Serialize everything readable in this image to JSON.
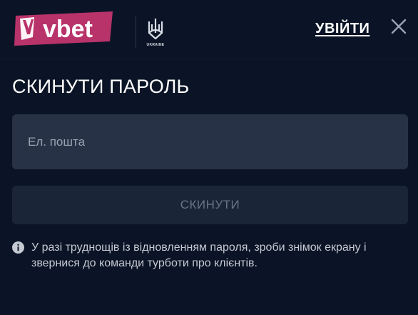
{
  "header": {
    "logo_text": "vbet",
    "partner_caption": "UKRAINE",
    "login_label": "УВІЙТИ"
  },
  "form": {
    "title": "СКИНУТИ ПАРОЛЬ",
    "email_placeholder": "Ел. пошта",
    "email_value": "",
    "submit_label": "СКИНУТИ",
    "info_text": "У разі труднощів із відновленням пароля, зроби знімок екрану і звернися до команди турботи про клієнтів."
  },
  "colors": {
    "background": "#0b1426",
    "input_bg": "#273246",
    "button_disabled_bg": "#1b2538",
    "brand_pink": "#b8336a"
  },
  "icons": {
    "logo": "vbet-logo-icon",
    "trident": "ukraine-trident-icon",
    "close": "close-icon",
    "info": "info-icon"
  }
}
